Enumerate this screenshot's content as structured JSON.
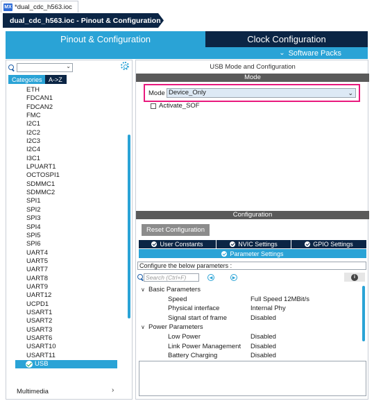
{
  "window": {
    "file_tab": "*dual_cdc_h563.ioc",
    "breadcrumb": "dual_cdc_h563.ioc - Pinout & Configuration"
  },
  "tabs": {
    "pinout": "Pinout & Configuration",
    "clock": "Clock Configuration",
    "software_packs": "Software Packs"
  },
  "sidebar": {
    "category_tabs": [
      "Categories",
      "A->Z"
    ],
    "items": [
      "ETH",
      "FDCAN1",
      "FDCAN2",
      "FMC",
      "I2C1",
      "I2C2",
      "I2C3",
      "I2C4",
      "I3C1",
      "LPUART1",
      "OCTOSPI1",
      "SDMMC1",
      "SDMMC2",
      "SPI1",
      "SPI2",
      "SPI3",
      "SPI4",
      "SPI5",
      "SPI6",
      "UART4",
      "UART5",
      "UART7",
      "UART8",
      "UART9",
      "UART12",
      "UCPD1",
      "USART1",
      "USART2",
      "USART3",
      "USART6",
      "USART10",
      "USART11"
    ],
    "selected_item": "USB",
    "group_footer": "Multimedia"
  },
  "mode_panel": {
    "title": "USB Mode and Configuration",
    "header": "Mode",
    "mode_label": "Mode",
    "mode_value": "Device_Only",
    "activate_sof": "Activate_SOF"
  },
  "config_panel": {
    "header": "Configuration",
    "reset_button": "Reset Configuration",
    "tabs": [
      "User Constants",
      "NVIC Settings",
      "GPIO Settings"
    ],
    "active_tab": "Parameter Settings",
    "description": "Configure the below parameters :",
    "search_placeholder": "Search (Ctrl+F)",
    "groups": [
      {
        "name": "Basic Parameters",
        "params": [
          {
            "name": "Speed",
            "value": "Full Speed 12MBit/s"
          },
          {
            "name": "Physical interface",
            "value": "Internal Phy"
          },
          {
            "name": "Signal start of frame",
            "value": "Disabled"
          }
        ]
      },
      {
        "name": "Power Parameters",
        "params": [
          {
            "name": "Low Power",
            "value": "Disabled"
          },
          {
            "name": "Link Power Management",
            "value": "Disabled"
          },
          {
            "name": "Battery Charging",
            "value": "Disabled"
          }
        ]
      }
    ]
  }
}
